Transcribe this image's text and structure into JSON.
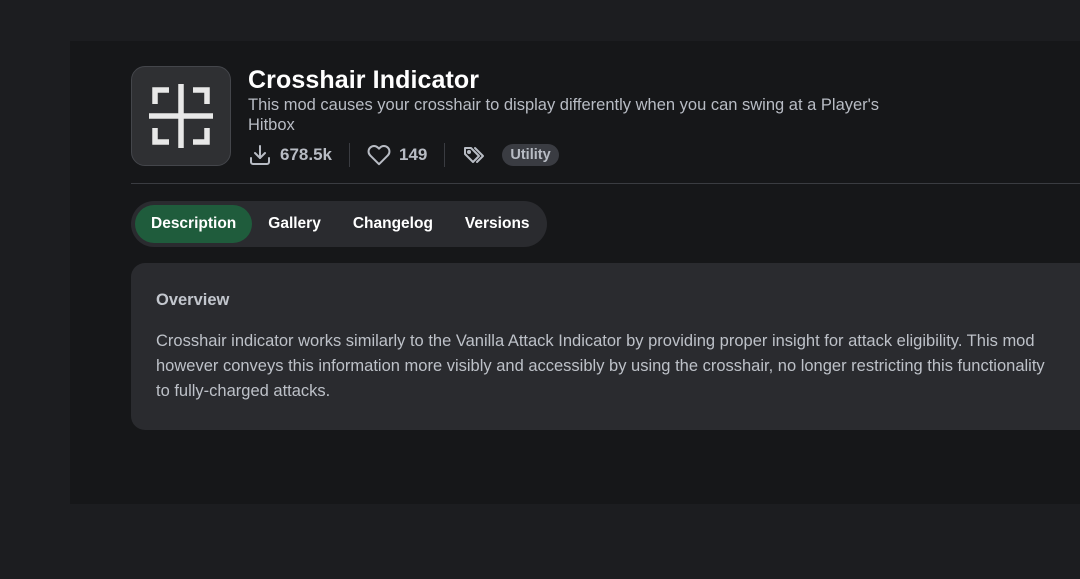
{
  "project": {
    "title": "Crosshair Indicator",
    "summary": "This mod causes your crosshair to display differently when you can swing at a Player's Hitbox",
    "downloads": "678.5k",
    "follows": "149",
    "tags": [
      "Utility"
    ]
  },
  "icons": {
    "logo": "crosshair-logo",
    "downloads": "download-icon",
    "follows": "heart-icon",
    "tags": "tags-icon"
  },
  "tabs": [
    {
      "label": "Description",
      "active": true
    },
    {
      "label": "Gallery",
      "active": false
    },
    {
      "label": "Changelog",
      "active": false
    },
    {
      "label": "Versions",
      "active": false
    }
  ],
  "description": {
    "heading": "Overview",
    "body": "Crosshair indicator works similarly to the Vanilla Attack Indicator by providing proper insight for attack eligibility. This mod however conveys this information more visibly and accessibly by using the crosshair, no longer restricting this functionality to fully-charged attacks."
  },
  "colors": {
    "active_tab": "#1f5c3c",
    "background": "#161719",
    "card": "#2a2b2f"
  }
}
